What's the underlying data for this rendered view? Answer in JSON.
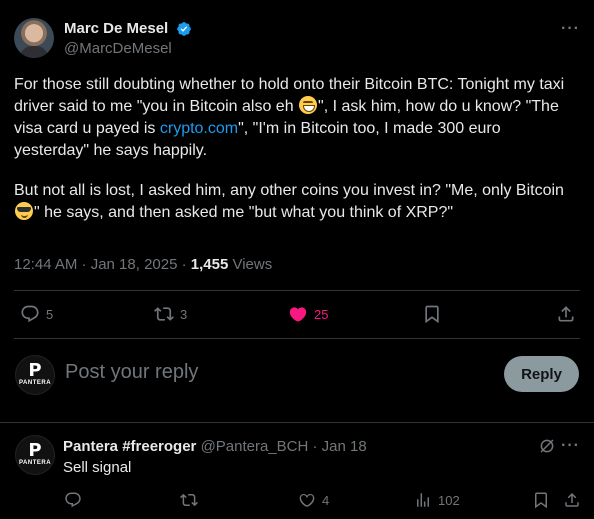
{
  "tweet": {
    "author_name": "Marc De Mesel",
    "author_handle": "@MarcDeMesel",
    "para1_a": "For those still doubting whether to hold onto their Bitcoin BTC: Tonight my taxi driver said to me \"you in Bitcoin also eh ",
    "para1_b": "\", I ask him, how do u know? \"The visa card u payed is ",
    "link": "crypto.com",
    "para1_c": "\", \"I'm in Bitcoin too, I made 300 euro yesterday\" he says happily.",
    "para2_a": "But not all is lost, I asked him, any other coins you invest in? \"Me, only Bitcoin ",
    "para2_b": "\" he says, and then asked me \"but what you think of XRP?\"",
    "time": "12:44 AM · Jan 18, 2025 · ",
    "views_count": "1,455",
    "views_label": " Views",
    "replies": "5",
    "reposts": "3",
    "likes": "25"
  },
  "composer": {
    "placeholder": "Post your reply",
    "reply_label": "Reply"
  },
  "reply": {
    "name": "Pantera #freeroger",
    "handle_date": " @Pantera_BCH · Jan 18",
    "text": "Sell signal",
    "likes": "4",
    "views": "102"
  },
  "avatar_text": {
    "pantera_letter": "P",
    "pantera_word": "PANTERA"
  },
  "colors": {
    "background": "#000000",
    "text": "#e7e9ea",
    "muted": "#71767b",
    "link": "#1d9bf0",
    "like": "#f91880",
    "divider": "#2f3336"
  }
}
